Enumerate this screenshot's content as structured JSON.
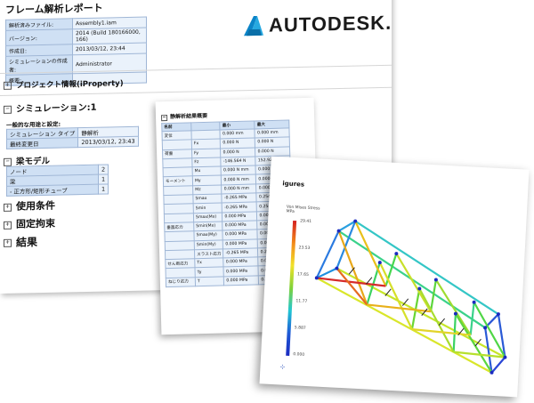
{
  "report": {
    "title": "フレーム解析レポート",
    "meta": [
      {
        "key": "解析済みファイル:",
        "value": "Assembly1.iam"
      },
      {
        "key": "バージョン:",
        "value": "2014 (Build 180166000, 166)"
      },
      {
        "key": "作成日:",
        "value": "2013/03/12, 23:44"
      },
      {
        "key": "シミュレーションの作成者:",
        "value": "Administrator"
      },
      {
        "key": "概要:",
        "value": ""
      }
    ],
    "logo_text": "AUTODESK",
    "project_info": "プロジェクト情報(iProperty)",
    "simulation_heading": "シミュレーション:1",
    "general_heading": "一般的な用途と設定:",
    "general": [
      {
        "key": "シミュレーション タイプ",
        "value": "静解析"
      },
      {
        "key": "最終変更日",
        "value": "2013/03/12, 23:43"
      }
    ],
    "beam_model": "梁モデル",
    "beam_rows": [
      {
        "key": "ノード",
        "value": "2"
      },
      {
        "key": "梁",
        "value": "1"
      },
      {
        "key": "- 正方形/矩形チューブ",
        "value": "1"
      }
    ],
    "sections": [
      "使用条件",
      "固定拘束",
      "結果"
    ]
  },
  "results_table": {
    "title": "静解析結果概要",
    "headers": [
      "名前",
      "",
      "最小",
      "最大"
    ],
    "rows": [
      [
        "変位",
        "",
        "0.000 mm",
        "0.000 mm"
      ],
      [
        "",
        "Fx",
        "0.000 N",
        "0.000 N"
      ],
      [
        "荷重",
        "Fy",
        "0.000 N",
        "0.000 N"
      ],
      [
        "",
        "Fz",
        "-146.564 N",
        "152.926 N"
      ],
      [
        "",
        "Mx",
        "0.000 N mm",
        "0.000 N mm"
      ],
      [
        "モーメント",
        "My",
        "0.000 N mm",
        "0.000 N mm"
      ],
      [
        "",
        "Mz",
        "0.000 N mm",
        "0.000 N mm"
      ],
      [
        "",
        "Smax",
        "-0.265 MPa",
        "0.254 MPa"
      ],
      [
        "",
        "Smin",
        "-0.265 MPa",
        "0.254 MPa"
      ],
      [
        "",
        "Smax(Mx)",
        "0.000 MPa",
        "0.000 MPa"
      ],
      [
        "垂直応力",
        "Smin(Mx)",
        "0.000 MPa",
        "0.000 MPa"
      ],
      [
        "",
        "Smax(My)",
        "0.000 MPa",
        "0.000 MPa"
      ],
      [
        "",
        "Smin(My)",
        "0.000 MPa",
        "0.000 MPa"
      ],
      [
        "",
        "スラスト応力",
        "-0.265 MPa",
        "0.254 MPa"
      ],
      [
        "せん断応力",
        "Tx",
        "0.000 MPa",
        "0.000 MPa"
      ],
      [
        "",
        "Ty",
        "0.000 MPa",
        "0.000 MPa"
      ],
      [
        "ねじり応力",
        "T",
        "0.000 MPa",
        "0.000 MPa"
      ]
    ]
  },
  "figures": {
    "title": "igures",
    "legend_title": "Von Mises Stress",
    "legend_unit": "MPa",
    "ticks": [
      "29.41",
      "23.53",
      "17.65",
      "11.77",
      "5.887",
      "0.000"
    ]
  },
  "colors": {
    "table_header": "#cfe0f4",
    "table_cell": "#eaf2fb",
    "table_border": "#9fb6d6",
    "logo_blue": "#0b84c8"
  }
}
